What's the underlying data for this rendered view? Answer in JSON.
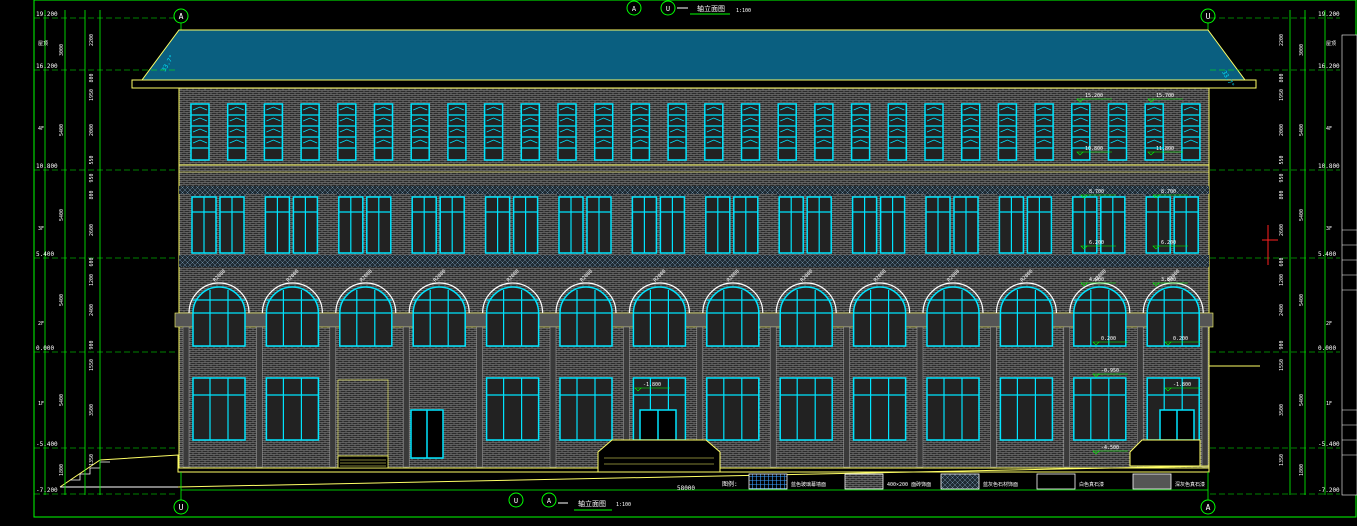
{
  "drawing": {
    "title_top": "Ⓤ—Ⓐ立面图",
    "title_top_parts": {
      "from": "U",
      "to": "A",
      "name": "轴立面图",
      "scale": "1:100"
    },
    "title_bottom_parts": {
      "from": "A",
      "to": "U",
      "name": "轴立面图",
      "scale": "1:100"
    },
    "axis_left": "A",
    "axis_right": "U",
    "axis_bottom_left": "U",
    "axis_bottom_right": "A",
    "total_width": "58000"
  },
  "levels_left": [
    {
      "label": "19.200"
    },
    {
      "label": "16.200"
    },
    {
      "label": "10.800"
    },
    {
      "label": "5.400"
    },
    {
      "label": "0.000"
    },
    {
      "label": "-5.400"
    },
    {
      "label": "-7.200"
    }
  ],
  "levels_right": [
    {
      "label": "19.200"
    },
    {
      "label": "16.200"
    },
    {
      "label": "10.800"
    },
    {
      "label": "5.400"
    },
    {
      "label": "0.000"
    },
    {
      "label": "-5.400"
    },
    {
      "label": "-7.200"
    }
  ],
  "floor_labels_left": [
    "屋顶",
    "4F",
    "3F",
    "2F",
    "1F"
  ],
  "floor_labels_right": [
    "屋顶",
    "4F",
    "3F",
    "2F",
    "1F"
  ],
  "dims_left_outer": [
    "3000",
    "5400",
    "5400",
    "5400",
    "5400",
    "1800"
  ],
  "dims_left_inner": [
    "2200",
    "800",
    "1950",
    "2000",
    "550",
    "950",
    "800",
    "2600",
    "600",
    "1200",
    "2400",
    "900",
    "1550",
    "3500",
    "1350"
  ],
  "facade_elevations": [
    {
      "label": "15.200"
    },
    {
      "label": "15.700"
    },
    {
      "label": "10.800"
    },
    {
      "label": "11.800"
    },
    {
      "label": "8.700"
    },
    {
      "label": "8.700"
    },
    {
      "label": "6.200"
    },
    {
      "label": "6.200"
    },
    {
      "label": "4.900"
    },
    {
      "label": "3.800"
    },
    {
      "label": "0.200"
    },
    {
      "label": "0.200"
    },
    {
      "label": "-0.950"
    },
    {
      "label": "-1.800"
    },
    {
      "label": "-1.800"
    },
    {
      "label": "-4.500"
    }
  ],
  "arch_labels": [
    "R2000"
  ],
  "legend": {
    "title": "图例:",
    "items": [
      {
        "swatch": "blue-grid",
        "label": "蓝色玻璃幕墙面"
      },
      {
        "swatch": "white-brick",
        "label": "400×200 面砖饰面"
      },
      {
        "swatch": "grey-stone",
        "label": "蓝灰色石材饰面"
      },
      {
        "swatch": "white",
        "label": "白色真石漆"
      },
      {
        "swatch": "dark-grey",
        "label": "深灰色真石漆"
      }
    ]
  },
  "colors": {
    "background": "#000000",
    "glass": "#00e5ff",
    "roof": "#0a5f80",
    "wall_hatch": "#8c8c8c",
    "dim_line": "#00ff00",
    "outline": "#ffff66",
    "text": "#ffffff",
    "accent_red": "#ff2020"
  }
}
